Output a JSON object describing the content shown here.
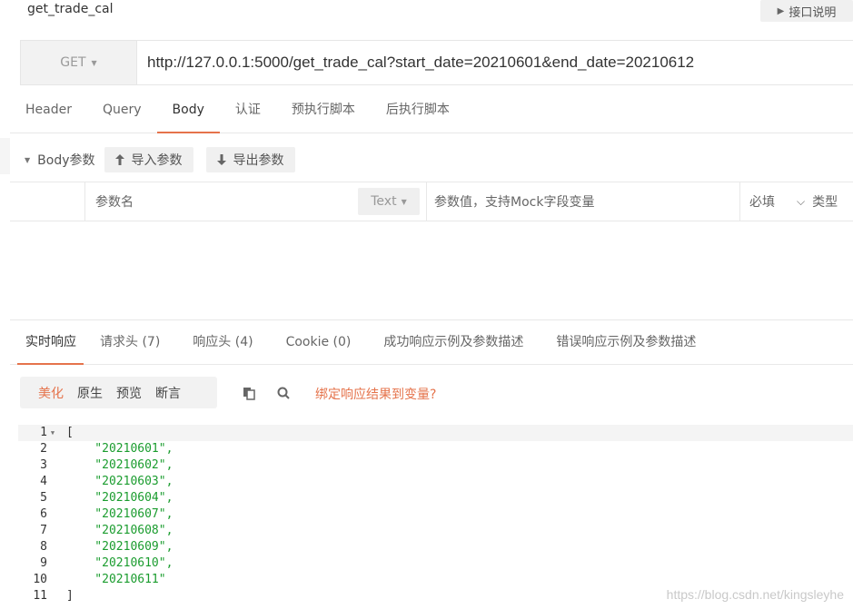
{
  "title": "get_trade_cal",
  "doc_button": "接口说明",
  "request": {
    "method": "GET",
    "url": "http://127.0.0.1:5000/get_trade_cal?start_date=20210601&end_date=20210612"
  },
  "request_tabs": [
    "Header",
    "Query",
    "Body",
    "认证",
    "预执行脚本",
    "后执行脚本"
  ],
  "body": {
    "label": "Body参数",
    "import_label": "导入参数",
    "export_label": "导出参数",
    "param_name_placeholder": "参数名",
    "type_label": "Text",
    "param_value_placeholder": "参数值，支持Mock字段变量",
    "required_label": "必填",
    "type_col_label": "类型"
  },
  "response_tabs": [
    "实时响应",
    "请求头 (7)",
    "响应头 (4)",
    "Cookie (0)",
    "成功响应示例及参数描述",
    "错误响应示例及参数描述"
  ],
  "view": {
    "options": [
      "美化",
      "原生",
      "预览",
      "断言"
    ],
    "bind_label": "绑定响应结果到变量?"
  },
  "response_lines": [
    {
      "n": "1",
      "text": "["
    },
    {
      "n": "2",
      "text": "    \"20210601\","
    },
    {
      "n": "3",
      "text": "    \"20210602\","
    },
    {
      "n": "4",
      "text": "    \"20210603\","
    },
    {
      "n": "5",
      "text": "    \"20210604\","
    },
    {
      "n": "6",
      "text": "    \"20210607\","
    },
    {
      "n": "7",
      "text": "    \"20210608\","
    },
    {
      "n": "8",
      "text": "    \"20210609\","
    },
    {
      "n": "9",
      "text": "    \"20210610\","
    },
    {
      "n": "10",
      "text": "    \"20210611\""
    },
    {
      "n": "11",
      "text": "]"
    }
  ],
  "watermark": "https://blog.csdn.net/kingsleyhe",
  "colors": {
    "accent": "#e5734b",
    "string": "#1a9c2e"
  }
}
